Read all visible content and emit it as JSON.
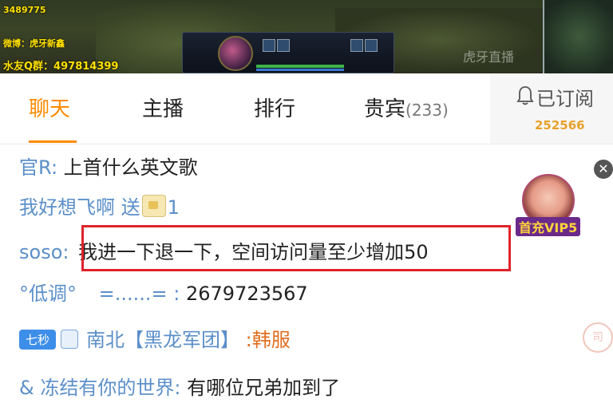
{
  "stream": {
    "overlay_lines": [
      "3489775",
      "微博：虎牙新鑫",
      "水友Q群：497814399"
    ],
    "watermark": "虎牙直播"
  },
  "tabs": [
    {
      "label": "聊天",
      "active": true
    },
    {
      "label": "主播",
      "active": false
    },
    {
      "label": "排行",
      "active": false
    },
    {
      "label": "贵宾",
      "count": "(233)",
      "active": false
    }
  ],
  "subscribe": {
    "label": "已订阅",
    "count": "252566"
  },
  "chat": [
    {
      "nick": "官R",
      "sep": ":",
      "message": "上首什么英文歌"
    },
    {
      "nick": "我好想飞啊",
      "action": "送",
      "gift_count": "1"
    },
    {
      "nick": "soso",
      "sep": ":",
      "message": "我进一下退一下，空间访问量至少增加50"
    },
    {
      "nick": "°低调°",
      "sep": "=......= :",
      "message": "2679723567"
    },
    {
      "badge": "七秒",
      "nick": "南北【黑龙军团】",
      "sep": ":",
      "message": "韩服"
    },
    {
      "nick": "& 冻结有你的世界",
      "sep": ":",
      "message": "有哪位兄弟加到了"
    }
  ],
  "vip": {
    "label": "首充VIP5"
  },
  "seal_text": "司",
  "colors": {
    "accent": "#ff8a00",
    "nick": "#5b8fc9",
    "highlight": "#e0232b",
    "badge": "#3d8ee8"
  }
}
